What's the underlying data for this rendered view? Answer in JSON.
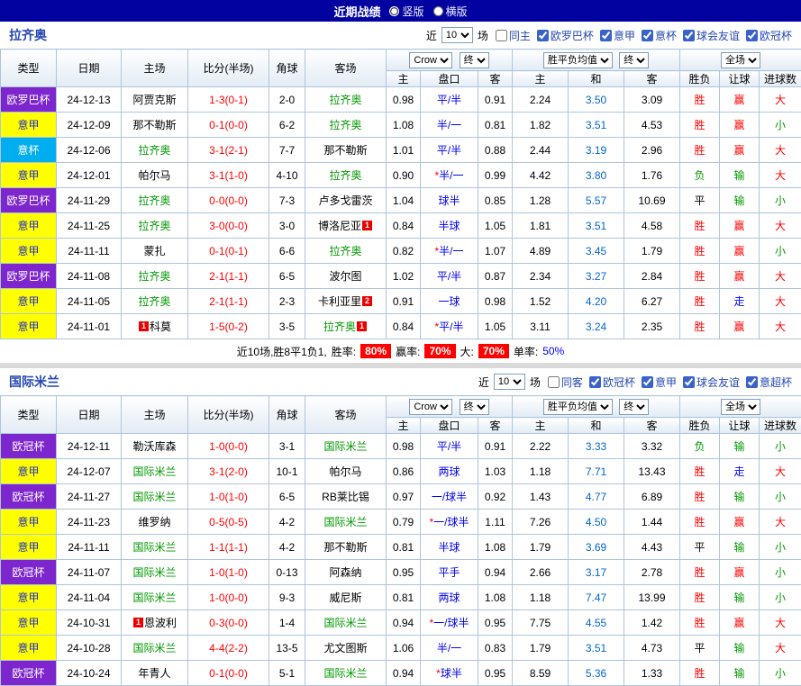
{
  "topbar": {
    "title": "近期战绩",
    "vertical_label": "竖版",
    "horizontal_label": "横版"
  },
  "filters": {
    "recent_label": "近",
    "games": "10",
    "unit_label": "场"
  },
  "table_headers": {
    "type": "类型",
    "date": "日期",
    "home": "主场",
    "score": "比分(半场)",
    "corner": "角球",
    "away": "客场",
    "ah_provider": "Crow",
    "ah_time": "终",
    "odds_provider": "胜平负均值",
    "odds_time": "终",
    "scope": "全场",
    "ah_home": "主",
    "ah_line": "盘口",
    "ah_away": "客",
    "odds_home": "主",
    "odds_draw": "和",
    "odds_away": "客",
    "result": "胜负",
    "handicap": "让球",
    "goals": "进球数"
  },
  "colors": {
    "topbar_navy": "#0202a0",
    "win_red": "#ff0000",
    "lose_green": "#009900",
    "push_blue": "#0000ff",
    "league_yellow": "#ffff00",
    "cup_purple": "#7d26cd",
    "coppa_cyan": "#00aeef",
    "focus_team_green": "#009900"
  },
  "sections": [
    {
      "team": "拉齐奥",
      "same_venue": "同主",
      "comps": [
        "欧罗巴杯",
        "意甲",
        "意杯",
        "球会友谊",
        "欧冠杯"
      ],
      "rows": [
        {
          "type": "欧罗巴杯",
          "type_color": "purple",
          "date": "24-12-13",
          "home": "阿贾克斯",
          "home_self": false,
          "score": "1-3(0-1)",
          "corner": "2-0",
          "away": "拉齐奥",
          "away_self": true,
          "ah_home": "0.98",
          "ah_line": "平/半",
          "ah_away": "0.91",
          "odds_home": "2.24",
          "odds_draw": "3.50",
          "odds_away": "3.09",
          "result": "胜",
          "result_color": "red",
          "handicap": "赢",
          "handicap_color": "red",
          "goals": "大",
          "goals_color": "red"
        },
        {
          "type": "意甲",
          "type_color": "yellow",
          "date": "24-12-09",
          "home": "那不勒斯",
          "home_self": false,
          "score": "0-1(0-0)",
          "corner": "6-2",
          "away": "拉齐奥",
          "away_self": true,
          "ah_home": "1.08",
          "ah_line": "半/一",
          "ah_away": "0.81",
          "odds_home": "1.82",
          "odds_draw": "3.51",
          "odds_away": "4.53",
          "result": "胜",
          "result_color": "red",
          "handicap": "赢",
          "handicap_color": "red",
          "goals": "小",
          "goals_color": "green"
        },
        {
          "type": "意杯",
          "type_color": "cyan",
          "date": "24-12-06",
          "home": "拉齐奥",
          "home_self": true,
          "score": "3-1(2-1)",
          "corner": "7-7",
          "away": "那不勒斯",
          "away_self": false,
          "ah_home": "1.01",
          "ah_line": "平/半",
          "ah_away": "0.88",
          "odds_home": "2.44",
          "odds_draw": "3.19",
          "odds_away": "2.96",
          "result": "胜",
          "result_color": "red",
          "handicap": "赢",
          "handicap_color": "red",
          "goals": "大",
          "goals_color": "red"
        },
        {
          "type": "意甲",
          "type_color": "yellow",
          "date": "24-12-01",
          "home": "帕尔马",
          "home_self": false,
          "score": "3-1(1-0)",
          "corner": "4-10",
          "away": "拉齐奥",
          "away_self": true,
          "ah_home": "0.90",
          "ah_star": "*",
          "ah_line": "半/一",
          "ah_away": "0.99",
          "odds_home": "4.42",
          "odds_draw": "3.80",
          "odds_away": "1.76",
          "result": "负",
          "result_color": "green",
          "handicap": "输",
          "handicap_color": "green",
          "goals": "大",
          "goals_color": "red"
        },
        {
          "type": "欧罗巴杯",
          "type_color": "purple",
          "date": "24-11-29",
          "home": "拉齐奥",
          "home_self": true,
          "score": "0-0(0-0)",
          "corner": "7-3",
          "away": "卢多戈雷茨",
          "away_self": false,
          "ah_home": "1.04",
          "ah_line": "球半",
          "ah_away": "0.85",
          "odds_home": "1.28",
          "odds_draw": "5.57",
          "odds_away": "10.69",
          "result": "平",
          "result_color": "black",
          "handicap": "输",
          "handicap_color": "green",
          "goals": "小",
          "goals_color": "green"
        },
        {
          "type": "意甲",
          "type_color": "yellow",
          "date": "24-11-25",
          "home": "拉齐奥",
          "home_self": true,
          "score": "3-0(0-0)",
          "corner": "3-0",
          "away": "博洛尼亚",
          "away_self": false,
          "away_badge": "1",
          "ah_home": "0.84",
          "ah_line": "半球",
          "ah_away": "1.05",
          "odds_home": "1.81",
          "odds_draw": "3.51",
          "odds_away": "4.58",
          "result": "胜",
          "result_color": "red",
          "handicap": "赢",
          "handicap_color": "red",
          "goals": "大",
          "goals_color": "red"
        },
        {
          "type": "意甲",
          "type_color": "yellow",
          "date": "24-11-11",
          "home": "蒙扎",
          "home_self": false,
          "score": "0-1(0-1)",
          "corner": "6-6",
          "away": "拉齐奥",
          "away_self": true,
          "ah_home": "0.82",
          "ah_star": "*",
          "ah_line": "半/一",
          "ah_away": "1.07",
          "odds_home": "4.89",
          "odds_draw": "3.45",
          "odds_away": "1.79",
          "result": "胜",
          "result_color": "red",
          "handicap": "赢",
          "handicap_color": "red",
          "goals": "小",
          "goals_color": "green"
        },
        {
          "type": "欧罗巴杯",
          "type_color": "purple",
          "date": "24-11-08",
          "home": "拉齐奥",
          "home_self": true,
          "score": "2-1(1-1)",
          "corner": "6-5",
          "away": "波尔图",
          "away_self": false,
          "ah_home": "1.02",
          "ah_line": "平/半",
          "ah_away": "0.87",
          "odds_home": "2.34",
          "odds_draw": "3.27",
          "odds_away": "2.84",
          "result": "胜",
          "result_color": "red",
          "handicap": "赢",
          "handicap_color": "red",
          "goals": "大",
          "goals_color": "red"
        },
        {
          "type": "意甲",
          "type_color": "yellow",
          "date": "24-11-05",
          "home": "拉齐奥",
          "home_self": true,
          "score": "2-1(1-1)",
          "corner": "2-3",
          "away": "卡利亚里",
          "away_self": false,
          "away_badge": "2",
          "ah_home": "0.91",
          "ah_line": "一球",
          "ah_away": "0.98",
          "odds_home": "1.52",
          "odds_draw": "4.20",
          "odds_away": "6.27",
          "result": "胜",
          "result_color": "red",
          "handicap": "走",
          "handicap_color": "blue",
          "goals": "大",
          "goals_color": "red"
        },
        {
          "type": "意甲",
          "type_color": "yellow",
          "date": "24-11-01",
          "home": "科莫",
          "home_self": false,
          "home_badge": "1",
          "score": "1-5(0-2)",
          "corner": "3-5",
          "away": "拉齐奥",
          "away_self": true,
          "away_badge": "1",
          "ah_home": "0.84",
          "ah_star": "*",
          "ah_line": "平/半",
          "ah_away": "1.05",
          "odds_home": "3.11",
          "odds_draw": "3.24",
          "odds_away": "2.35",
          "result": "胜",
          "result_color": "red",
          "handicap": "赢",
          "handicap_color": "red",
          "goals": "大",
          "goals_color": "red"
        }
      ],
      "summary": {
        "record": "近10场,胜8平1负1,",
        "win_rate_label": "胜率:",
        "win_rate": "80%",
        "cover_rate_label": "赢率:",
        "cover_rate": "70%",
        "big_rate_label": "大:",
        "big_rate": "70%",
        "odd_rate_label": "单率:",
        "odd_rate": "50%"
      }
    },
    {
      "team": "国际米兰",
      "same_venue": "同客",
      "comps": [
        "欧冠杯",
        "意甲",
        "球会友谊",
        "意超杯"
      ],
      "rows": [
        {
          "type": "欧冠杯",
          "type_color": "purple",
          "date": "24-12-11",
          "home": "勒沃库森",
          "home_self": false,
          "score": "1-0(0-0)",
          "corner": "3-1",
          "away": "国际米兰",
          "away_self": true,
          "ah_home": "0.98",
          "ah_line": "平/半",
          "ah_away": "0.91",
          "odds_home": "2.22",
          "odds_draw": "3.33",
          "odds_away": "3.32",
          "result": "负",
          "result_color": "green",
          "handicap": "输",
          "handicap_color": "green",
          "goals": "小",
          "goals_color": "green"
        },
        {
          "type": "意甲",
          "type_color": "yellow",
          "date": "24-12-07",
          "home": "国际米兰",
          "home_self": true,
          "score": "3-1(2-0)",
          "corner": "10-1",
          "away": "帕尔马",
          "away_self": false,
          "ah_home": "0.86",
          "ah_line": "两球",
          "ah_away": "1.03",
          "odds_home": "1.18",
          "odds_draw": "7.71",
          "odds_away": "13.43",
          "result": "胜",
          "result_color": "red",
          "handicap": "走",
          "handicap_color": "blue",
          "goals": "大",
          "goals_color": "red"
        },
        {
          "type": "欧冠杯",
          "type_color": "purple",
          "date": "24-11-27",
          "home": "国际米兰",
          "home_self": true,
          "score": "1-0(1-0)",
          "corner": "6-5",
          "away": "RB莱比锡",
          "away_self": false,
          "ah_home": "0.97",
          "ah_line": "一/球半",
          "ah_away": "0.92",
          "odds_home": "1.43",
          "odds_draw": "4.77",
          "odds_away": "6.89",
          "result": "胜",
          "result_color": "red",
          "handicap": "输",
          "handicap_color": "green",
          "goals": "小",
          "goals_color": "green"
        },
        {
          "type": "意甲",
          "type_color": "yellow",
          "date": "24-11-23",
          "home": "维罗纳",
          "home_self": false,
          "score": "0-5(0-5)",
          "corner": "4-2",
          "away": "国际米兰",
          "away_self": true,
          "ah_home": "0.79",
          "ah_star": "*",
          "ah_line": "一/球半",
          "ah_away": "1.11",
          "odds_home": "7.26",
          "odds_draw": "4.50",
          "odds_away": "1.44",
          "result": "胜",
          "result_color": "red",
          "handicap": "赢",
          "handicap_color": "red",
          "goals": "大",
          "goals_color": "red"
        },
        {
          "type": "意甲",
          "type_color": "yellow",
          "date": "24-11-11",
          "home": "国际米兰",
          "home_self": true,
          "score": "1-1(1-1)",
          "corner": "4-2",
          "away": "那不勒斯",
          "away_self": false,
          "ah_home": "0.81",
          "ah_line": "半球",
          "ah_away": "1.08",
          "odds_home": "1.79",
          "odds_draw": "3.69",
          "odds_away": "4.43",
          "result": "平",
          "result_color": "black",
          "handicap": "输",
          "handicap_color": "green",
          "goals": "小",
          "goals_color": "green"
        },
        {
          "type": "欧冠杯",
          "type_color": "purple",
          "date": "24-11-07",
          "home": "国际米兰",
          "home_self": true,
          "score": "1-0(1-0)",
          "corner": "0-13",
          "away": "阿森纳",
          "away_self": false,
          "ah_home": "0.95",
          "ah_line": "平手",
          "ah_away": "0.94",
          "odds_home": "2.66",
          "odds_draw": "3.17",
          "odds_away": "2.78",
          "result": "胜",
          "result_color": "red",
          "handicap": "赢",
          "handicap_color": "red",
          "goals": "小",
          "goals_color": "green"
        },
        {
          "type": "意甲",
          "type_color": "yellow",
          "date": "24-11-04",
          "home": "国际米兰",
          "home_self": true,
          "score": "1-0(0-0)",
          "corner": "9-3",
          "away": "威尼斯",
          "away_self": false,
          "ah_home": "0.81",
          "ah_line": "两球",
          "ah_away": "1.08",
          "odds_home": "1.18",
          "odds_draw": "7.47",
          "odds_away": "13.99",
          "result": "胜",
          "result_color": "red",
          "handicap": "输",
          "handicap_color": "green",
          "goals": "小",
          "goals_color": "green"
        },
        {
          "type": "意甲",
          "type_color": "yellow",
          "date": "24-10-31",
          "home": "恩波利",
          "home_self": false,
          "home_badge": "1",
          "score": "0-3(0-0)",
          "corner": "1-4",
          "away": "国际米兰",
          "away_self": true,
          "ah_home": "0.94",
          "ah_star": "*",
          "ah_line": "一/球半",
          "ah_away": "0.95",
          "odds_home": "7.75",
          "odds_draw": "4.55",
          "odds_away": "1.42",
          "result": "胜",
          "result_color": "red",
          "handicap": "赢",
          "handicap_color": "red",
          "goals": "大",
          "goals_color": "red"
        },
        {
          "type": "意甲",
          "type_color": "yellow",
          "date": "24-10-28",
          "home": "国际米兰",
          "home_self": true,
          "score": "4-4(2-2)",
          "corner": "13-5",
          "away": "尤文图斯",
          "away_self": false,
          "ah_home": "1.06",
          "ah_line": "半/一",
          "ah_away": "0.83",
          "odds_home": "1.79",
          "odds_draw": "3.51",
          "odds_away": "4.73",
          "result": "平",
          "result_color": "black",
          "handicap": "输",
          "handicap_color": "green",
          "goals": "大",
          "goals_color": "red"
        },
        {
          "type": "欧冠杯",
          "type_color": "purple",
          "date": "24-10-24",
          "home": "年青人",
          "home_self": false,
          "score": "0-1(0-0)",
          "corner": "5-1",
          "away": "国际米兰",
          "away_self": true,
          "ah_home": "0.94",
          "ah_star": "*",
          "ah_line": "球半",
          "ah_away": "0.95",
          "odds_home": "8.59",
          "odds_draw": "5.36",
          "odds_away": "1.33",
          "result": "胜",
          "result_color": "red",
          "handicap": "输",
          "handicap_color": "green",
          "goals": "小",
          "goals_color": "green"
        }
      ]
    }
  ]
}
